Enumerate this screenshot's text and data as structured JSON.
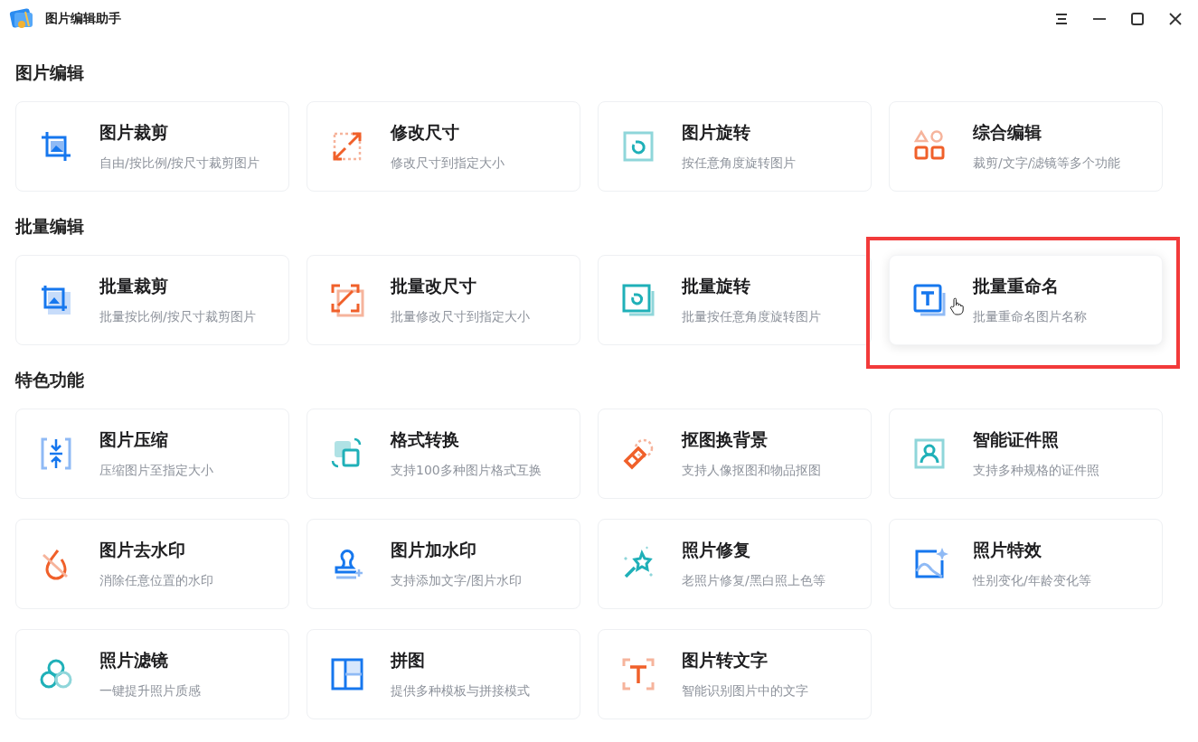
{
  "window": {
    "title": "图片编辑助手"
  },
  "sections": [
    {
      "title": "图片编辑",
      "cards": [
        {
          "kind": "crop",
          "title": "图片裁剪",
          "subtitle": "自由/按比例/按尺寸裁剪图片",
          "hovered": false,
          "highlighted": false
        },
        {
          "kind": "resize",
          "title": "修改尺寸",
          "subtitle": "修改尺寸到指定大小",
          "hovered": false,
          "highlighted": false
        },
        {
          "kind": "rotate",
          "title": "图片旋转",
          "subtitle": "按任意角度旋转图片",
          "hovered": false,
          "highlighted": false
        },
        {
          "kind": "shapes",
          "title": "综合编辑",
          "subtitle": "裁剪/文字/滤镜等多个功能",
          "hovered": false,
          "highlighted": false
        }
      ]
    },
    {
      "title": "批量编辑",
      "cards": [
        {
          "kind": "batch-crop",
          "title": "批量裁剪",
          "subtitle": "批量按比例/按尺寸裁剪图片",
          "hovered": false,
          "highlighted": false
        },
        {
          "kind": "batch-resize",
          "title": "批量改尺寸",
          "subtitle": "批量修改尺寸到指定大小",
          "hovered": false,
          "highlighted": false
        },
        {
          "kind": "batch-rotate",
          "title": "批量旋转",
          "subtitle": "批量按任意角度旋转图片",
          "hovered": false,
          "highlighted": false
        },
        {
          "kind": "rename",
          "title": "批量重命名",
          "subtitle": "批量重命名图片名称",
          "hovered": true,
          "highlighted": true
        }
      ]
    },
    {
      "title": "特色功能",
      "cards": [
        {
          "kind": "compress",
          "title": "图片压缩",
          "subtitle": "压缩图片至指定大小",
          "hovered": false,
          "highlighted": false
        },
        {
          "kind": "convert",
          "title": "格式转换",
          "subtitle": "支持100多种图片格式互换",
          "hovered": false,
          "highlighted": false
        },
        {
          "kind": "cutout",
          "title": "抠图换背景",
          "subtitle": "支持人像抠图和物品抠图",
          "hovered": false,
          "highlighted": false
        },
        {
          "kind": "id-photo",
          "title": "智能证件照",
          "subtitle": "支持多种规格的证件照",
          "hovered": false,
          "highlighted": false
        },
        {
          "kind": "watermark-remove",
          "title": "图片去水印",
          "subtitle": "消除任意位置的水印",
          "hovered": false,
          "highlighted": false
        },
        {
          "kind": "watermark-add",
          "title": "图片加水印",
          "subtitle": "支持添加文字/图片水印",
          "hovered": false,
          "highlighted": false
        },
        {
          "kind": "repair",
          "title": "照片修复",
          "subtitle": "老照片修复/黑白照上色等",
          "hovered": false,
          "highlighted": false
        },
        {
          "kind": "effects",
          "title": "照片特效",
          "subtitle": "性别变化/年龄变化等",
          "hovered": false,
          "highlighted": false
        },
        {
          "kind": "filter",
          "title": "照片滤镜",
          "subtitle": "一键提升照片质感",
          "hovered": false,
          "highlighted": false
        },
        {
          "kind": "collage",
          "title": "拼图",
          "subtitle": "提供多种模板与拼接模式",
          "hovered": false,
          "highlighted": false
        },
        {
          "kind": "ocr",
          "title": "图片转文字",
          "subtitle": "智能识别图片中的文字",
          "hovered": false,
          "highlighted": false
        }
      ]
    }
  ]
}
